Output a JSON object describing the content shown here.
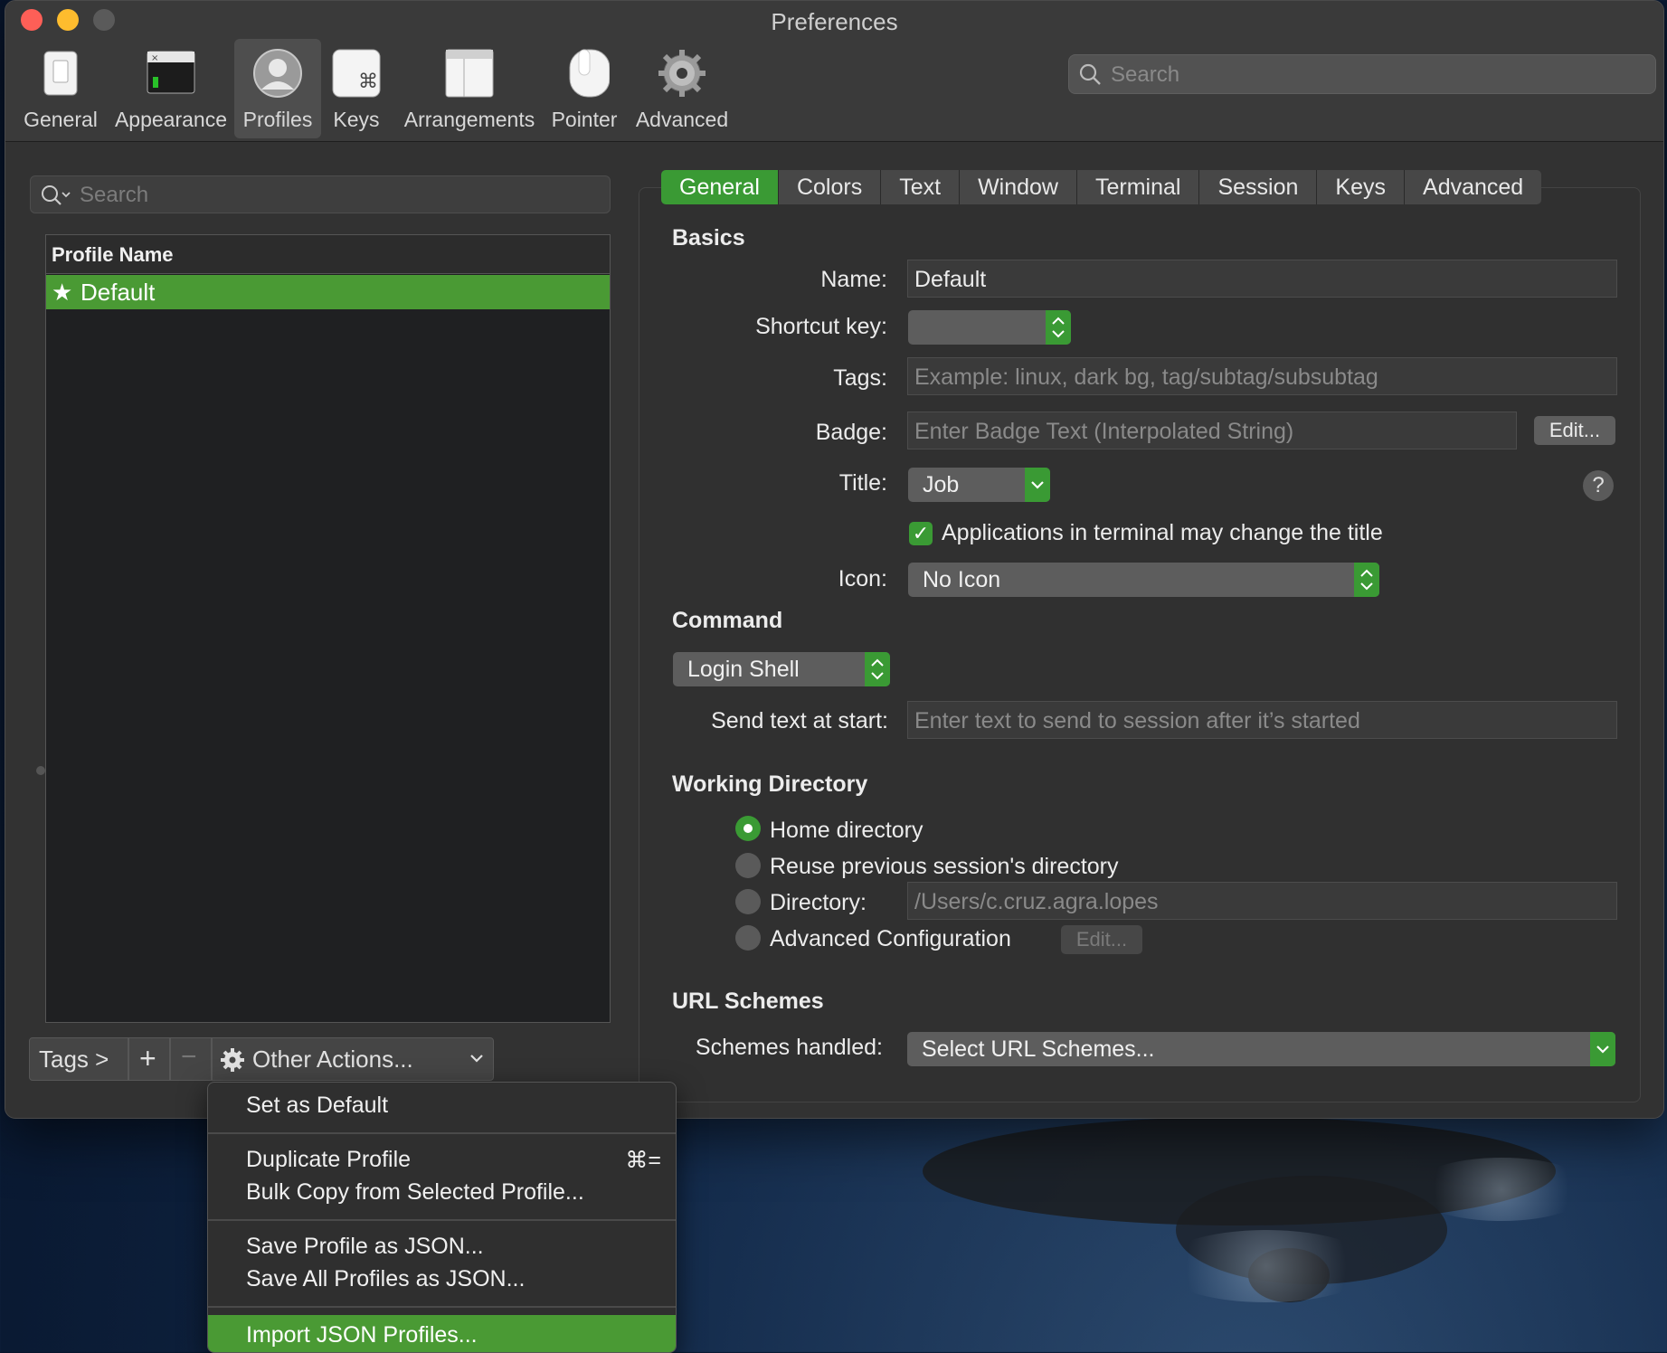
{
  "window": {
    "title": "Preferences"
  },
  "toolbar": {
    "items": [
      {
        "label": "General",
        "icon": "switch-icon"
      },
      {
        "label": "Appearance",
        "icon": "appearance-window-icon"
      },
      {
        "label": "Profiles",
        "icon": "user-profile-icon"
      },
      {
        "label": "Keys",
        "icon": "command-key-icon"
      },
      {
        "label": "Arrangements",
        "icon": "window-arrangement-icon"
      },
      {
        "label": "Pointer",
        "icon": "mouse-icon"
      },
      {
        "label": "Advanced",
        "icon": "gear-icon"
      }
    ],
    "selected": "Profiles",
    "search_placeholder": "Search"
  },
  "profiles_panel": {
    "search_placeholder": "Search",
    "column_header": "Profile Name",
    "profiles": [
      {
        "name": "Default",
        "is_default": true,
        "selected": true
      }
    ],
    "tags_button": "Tags >",
    "add_symbol": "+",
    "remove_symbol": "−",
    "other_actions_label": "Other Actions..."
  },
  "tabs": [
    "General",
    "Colors",
    "Text",
    "Window",
    "Terminal",
    "Session",
    "Keys",
    "Advanced"
  ],
  "active_tab": "General",
  "basics": {
    "section_title": "Basics",
    "name_label": "Name:",
    "name_value": "Default",
    "shortcut_label": "Shortcut key:",
    "shortcut_value": "",
    "tags_label": "Tags:",
    "tags_placeholder": "Example: linux, dark bg, tag/subtag/subsubtag",
    "badge_label": "Badge:",
    "badge_placeholder": "Enter Badge Text (Interpolated String)",
    "badge_edit": "Edit...",
    "title_label": "Title:",
    "title_value": "Job",
    "help_symbol": "?",
    "apps_change_title": "Applications in terminal may change the title",
    "apps_change_title_checked": true,
    "icon_label": "Icon:",
    "icon_value": "No Icon"
  },
  "command": {
    "section_title": "Command",
    "shell_value": "Login Shell",
    "send_text_label": "Send text at start:",
    "send_text_placeholder": "Enter text to send to session after it’s started"
  },
  "working_directory": {
    "section_title": "Working Directory",
    "options": [
      {
        "label": "Home directory",
        "selected": true
      },
      {
        "label": "Reuse previous session's directory",
        "selected": false
      },
      {
        "label": "Directory:",
        "selected": false
      },
      {
        "label": "Advanced Configuration",
        "selected": false
      }
    ],
    "directory_placeholder": "/Users/c.cruz.agra.lopes",
    "advanced_edit": "Edit..."
  },
  "url_schemes": {
    "section_title": "URL Schemes",
    "handled_label": "Schemes handled:",
    "select_value": "Select URL Schemes..."
  },
  "context_menu": {
    "items": [
      {
        "label": "Set as Default",
        "shortcut": ""
      },
      {
        "label": "Duplicate Profile",
        "shortcut": "⌘="
      },
      {
        "label": "Bulk Copy from Selected Profile...",
        "shortcut": ""
      },
      {
        "label": "Save Profile as JSON...",
        "shortcut": ""
      },
      {
        "label": "Save All Profiles as JSON...",
        "shortcut": ""
      },
      {
        "label": "Import JSON Profiles...",
        "shortcut": ""
      }
    ],
    "highlighted": "Import JSON Profiles..."
  },
  "colors": {
    "accent_green": "#3a9a34",
    "window_bg": "#323232",
    "close": "#fe5f57",
    "minimize": "#febc2e"
  }
}
